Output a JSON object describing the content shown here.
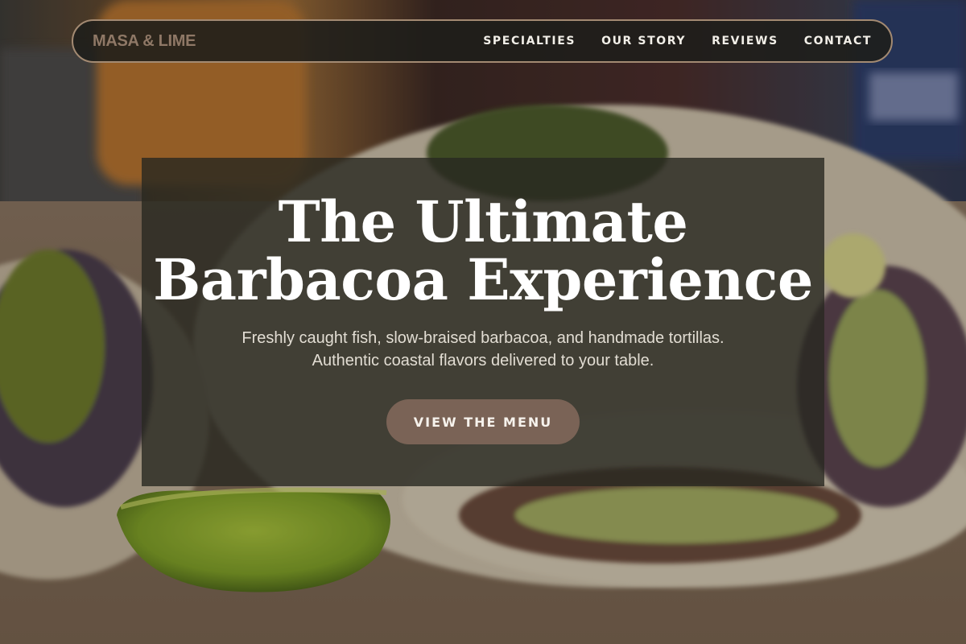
{
  "brand": {
    "name": "MASA & LIME",
    "color": "#8f7866"
  },
  "nav": {
    "items": [
      {
        "label": "SPECIALTIES"
      },
      {
        "label": "OUR STORY"
      },
      {
        "label": "REVIEWS"
      },
      {
        "label": "CONTACT"
      }
    ],
    "border_color": "#a38a72"
  },
  "hero": {
    "title_line1": "The Ultimate",
    "title_line2": "Barbacoa Experience",
    "subtitle_line1": "Freshly caught fish, slow-braised barbacoa, and handmade tortillas.",
    "subtitle_line2": "Authentic coastal flavors delivered to your table.",
    "cta_label": "VIEW THE MENU",
    "cta_color": "#7a6356",
    "background_image": "tacos-with-lime-photo"
  }
}
